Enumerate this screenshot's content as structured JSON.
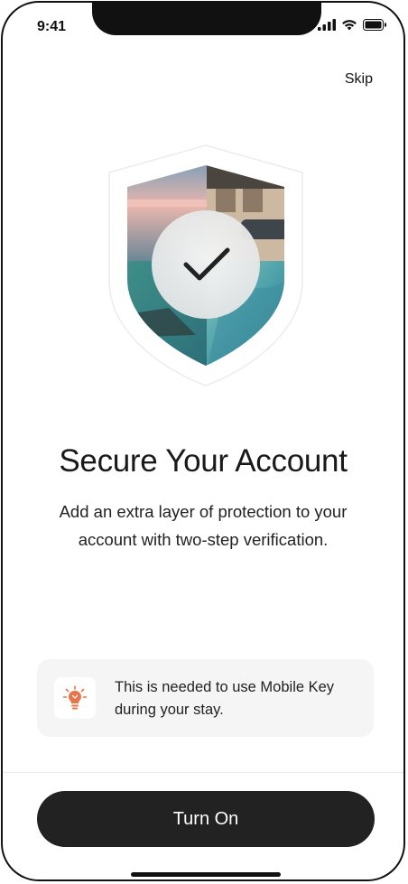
{
  "status_bar": {
    "time": "9:41",
    "icons": [
      "cellular-signal-icon",
      "wifi-icon",
      "battery-icon"
    ]
  },
  "header": {
    "skip_label": "Skip"
  },
  "hero": {
    "image": "shield-photo-collage",
    "overlay_icon": "checkmark-icon"
  },
  "content": {
    "title": "Secure Your Account",
    "subtitle": "Add an extra layer of protection to your account with two-step verification."
  },
  "note": {
    "icon": "lightbulb-icon",
    "icon_color": "#e8744a",
    "text": "This is needed to use Mobile Key during your stay."
  },
  "footer": {
    "primary_button_label": "Turn On"
  },
  "colors": {
    "button_bg": "#222222",
    "button_text": "#ffffff",
    "note_bg": "#f5f5f5"
  }
}
